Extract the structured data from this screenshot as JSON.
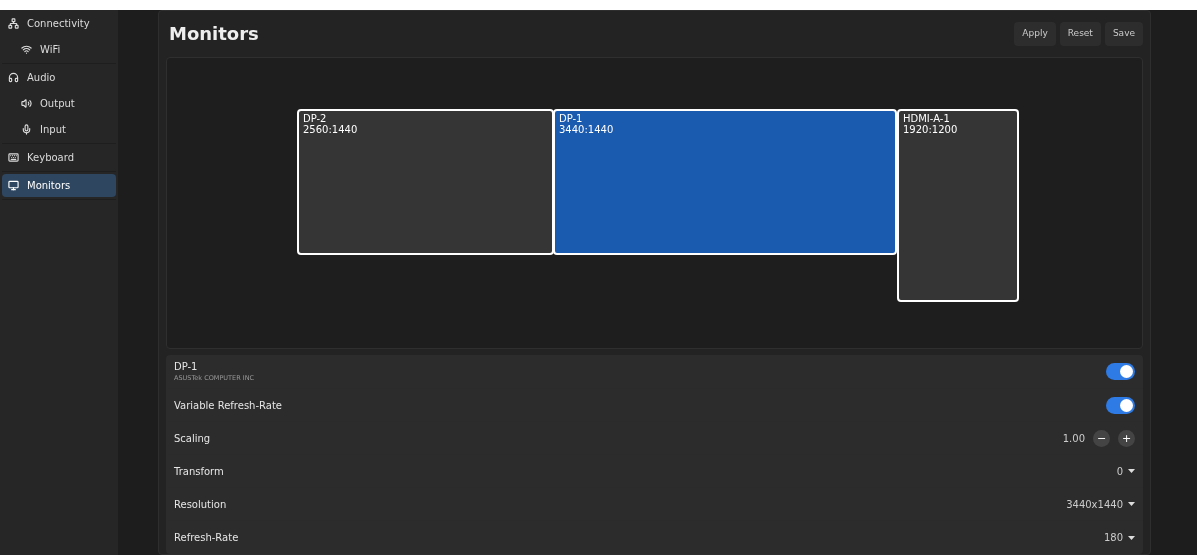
{
  "sidebar": {
    "items": [
      {
        "label": "Connectivity",
        "kind": "network",
        "selected": false,
        "children": [
          {
            "label": "WiFi",
            "kind": "wifi",
            "selected": false
          }
        ]
      },
      {
        "label": "Audio",
        "kind": "headphones",
        "selected": false,
        "children": [
          {
            "label": "Output",
            "kind": "speaker",
            "selected": false
          },
          {
            "label": "Input",
            "kind": "mic",
            "selected": false
          }
        ]
      },
      {
        "label": "Keyboard",
        "kind": "keyboard",
        "selected": false
      },
      {
        "label": "Monitors",
        "kind": "monitor",
        "selected": true
      }
    ]
  },
  "header": {
    "title": "Monitors",
    "buttons": [
      "Apply",
      "Reset",
      "Save"
    ]
  },
  "monitors": [
    {
      "name": "DP-2",
      "mode": "2560:1440",
      "selected": false
    },
    {
      "name": "DP-1",
      "mode": "3440:1440",
      "selected": true
    },
    {
      "name": "HDMI-A-1",
      "mode": "1920:1200",
      "selected": false
    }
  ],
  "settings": [
    {
      "kind": "toggle",
      "label": "DP-1",
      "sublabel": "ASUSTek COMPUTER INC",
      "on": true
    },
    {
      "kind": "toggle",
      "label": "Variable Refresh-Rate",
      "on": true
    },
    {
      "kind": "stepper",
      "label": "Scaling",
      "value": "1.00",
      "minus": "−",
      "plus": "+"
    },
    {
      "kind": "dropdown",
      "label": "Transform",
      "value": "0"
    },
    {
      "kind": "dropdown",
      "label": "Resolution",
      "value": "3440x1440"
    },
    {
      "kind": "dropdown",
      "label": "Refresh-Rate",
      "value": "180"
    }
  ]
}
